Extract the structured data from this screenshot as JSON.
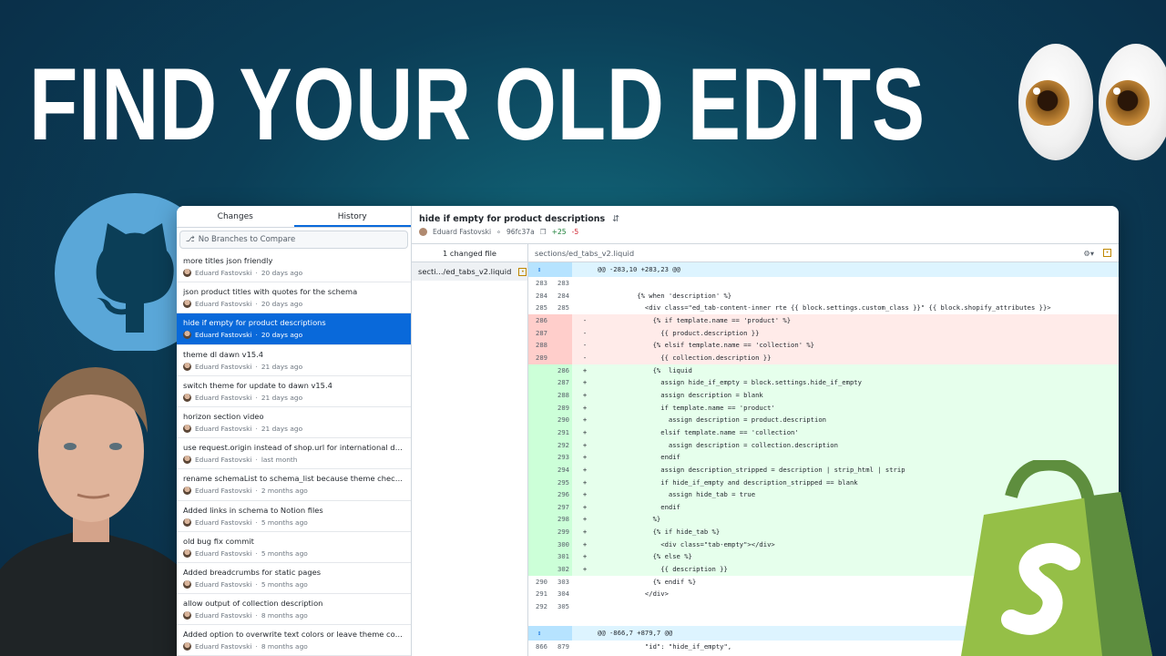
{
  "headline": "FIND YOUR OLD EDITS",
  "tabs": [
    "Changes",
    "History"
  ],
  "branch_placeholder": "No Branches to Compare",
  "commits": [
    {
      "title": "more titles json friendly",
      "author": "Eduard Fastovski",
      "time": "20 days ago"
    },
    {
      "title": "json product titles with quotes for the schema",
      "author": "Eduard Fastovski",
      "time": "20 days ago"
    },
    {
      "title": "hide if empty for product descriptions",
      "author": "Eduard Fastovski",
      "time": "20 days ago"
    },
    {
      "title": "theme dl dawn v15.4",
      "author": "Eduard Fastovski",
      "time": "21 days ago"
    },
    {
      "title": "switch theme for update to dawn v15.4",
      "author": "Eduard Fastovski",
      "time": "21 days ago"
    },
    {
      "title": "horizon section video",
      "author": "Eduard Fastovski",
      "time": "21 days ago"
    },
    {
      "title": "use request.origin instead of shop.url for international do...",
      "author": "Eduard Fastovski",
      "time": "last month"
    },
    {
      "title": "rename schemaList to schema_list because theme check ...",
      "author": "Eduard Fastovski",
      "time": "2 months ago"
    },
    {
      "title": "Added links in schema to Notion files",
      "author": "Eduard Fastovski",
      "time": "5 months ago"
    },
    {
      "title": "old bug fix commit",
      "author": "Eduard Fastovski",
      "time": "5 months ago"
    },
    {
      "title": "Added breadcrumbs for static pages",
      "author": "Eduard Fastovski",
      "time": "5 months ago"
    },
    {
      "title": "allow output of collection description",
      "author": "Eduard Fastovski",
      "time": "8 months ago"
    },
    {
      "title": "Added option to overwrite text colors or leave theme colo...",
      "author": "Eduard Fastovski",
      "time": "8 months ago"
    }
  ],
  "selected_commit_index": 2,
  "commit_header": {
    "title": "hide if empty for product descriptions",
    "author": "Eduard Fastovski",
    "sha": "96fc37a",
    "additions": "+25",
    "deletions": "-5"
  },
  "files": {
    "count_label": "1 changed file",
    "file_name": "secti.../ed_tabs_v2.liquid"
  },
  "diff_path": "sections/ed_tabs_v2.liquid",
  "diff_lines": [
    {
      "type": "hunk",
      "old": "",
      "new": "",
      "sign": "",
      "code": "@@ -283,10 +283,23 @@"
    },
    {
      "type": "ctx",
      "old": "283",
      "new": "283",
      "sign": "",
      "code": ""
    },
    {
      "type": "ctx",
      "old": "284",
      "new": "284",
      "sign": "",
      "code": "          {% when 'description' %}"
    },
    {
      "type": "ctx",
      "old": "285",
      "new": "285",
      "sign": "",
      "code": "            <div class=\"ed_tab-content-inner rte {{ block.settings.custom_class }}\" {{ block.shopify_attributes }}>"
    },
    {
      "type": "del",
      "old": "286",
      "new": "",
      "sign": "-",
      "code": "              {% if template.name == 'product' %}"
    },
    {
      "type": "del",
      "old": "287",
      "new": "",
      "sign": "-",
      "code": "                {{ product.description }}"
    },
    {
      "type": "del",
      "old": "288",
      "new": "",
      "sign": "-",
      "code": "              {% elsif template.name == 'collection' %}"
    },
    {
      "type": "del",
      "old": "289",
      "new": "",
      "sign": "-",
      "code": "                {{ collection.description }}"
    },
    {
      "type": "add",
      "old": "",
      "new": "286",
      "sign": "+",
      "code": "              {%  liquid"
    },
    {
      "type": "add",
      "old": "",
      "new": "287",
      "sign": "+",
      "code": "                assign hide_if_empty = block.settings.hide_if_empty"
    },
    {
      "type": "add",
      "old": "",
      "new": "288",
      "sign": "+",
      "code": "                assign description = blank"
    },
    {
      "type": "add",
      "old": "",
      "new": "289",
      "sign": "+",
      "code": "                if template.name == 'product'"
    },
    {
      "type": "add",
      "old": "",
      "new": "290",
      "sign": "+",
      "code": "                  assign description = product.description"
    },
    {
      "type": "add",
      "old": "",
      "new": "291",
      "sign": "+",
      "code": "                elsif template.name == 'collection'"
    },
    {
      "type": "add",
      "old": "",
      "new": "292",
      "sign": "+",
      "code": "                  assign description = collection.description"
    },
    {
      "type": "add",
      "old": "",
      "new": "293",
      "sign": "+",
      "code": "                endif"
    },
    {
      "type": "add",
      "old": "",
      "new": "294",
      "sign": "+",
      "code": "                assign description_stripped = description | strip_html | strip"
    },
    {
      "type": "add",
      "old": "",
      "new": "295",
      "sign": "+",
      "code": "                if hide_if_empty and description_stripped == blank"
    },
    {
      "type": "add",
      "old": "",
      "new": "296",
      "sign": "+",
      "code": "                  assign hide_tab = true"
    },
    {
      "type": "add",
      "old": "",
      "new": "297",
      "sign": "+",
      "code": "                endif"
    },
    {
      "type": "add",
      "old": "",
      "new": "298",
      "sign": "+",
      "code": "              %}"
    },
    {
      "type": "add",
      "old": "",
      "new": "299",
      "sign": "+",
      "code": "              {% if hide_tab %}"
    },
    {
      "type": "add",
      "old": "",
      "new": "300",
      "sign": "+",
      "code": "                <div class=\"tab-empty\"></div>"
    },
    {
      "type": "add",
      "old": "",
      "new": "301",
      "sign": "+",
      "code": "              {% else %}"
    },
    {
      "type": "add",
      "old": "",
      "new": "302",
      "sign": "+",
      "code": "                {{ description }}"
    },
    {
      "type": "ctx",
      "old": "290",
      "new": "303",
      "sign": "",
      "code": "              {% endif %}"
    },
    {
      "type": "ctx",
      "old": "291",
      "new": "304",
      "sign": "",
      "code": "            </div>"
    },
    {
      "type": "ctx",
      "old": "292",
      "new": "305",
      "sign": "",
      "code": ""
    },
    {
      "type": "gap",
      "old": "",
      "new": "",
      "sign": "",
      "code": ""
    },
    {
      "type": "hunk",
      "old": "",
      "new": "",
      "sign": "",
      "code": "@@ -866,7 +879,7 @@"
    },
    {
      "type": "ctx",
      "old": "866",
      "new": "879",
      "sign": "",
      "code": "            \"id\": \"hide_if_empty\","
    }
  ],
  "colors": {
    "accent": "#0969da",
    "add_bg": "#e6ffec",
    "del_bg": "#ffebe9",
    "hunk_bg": "#ddf4ff"
  }
}
